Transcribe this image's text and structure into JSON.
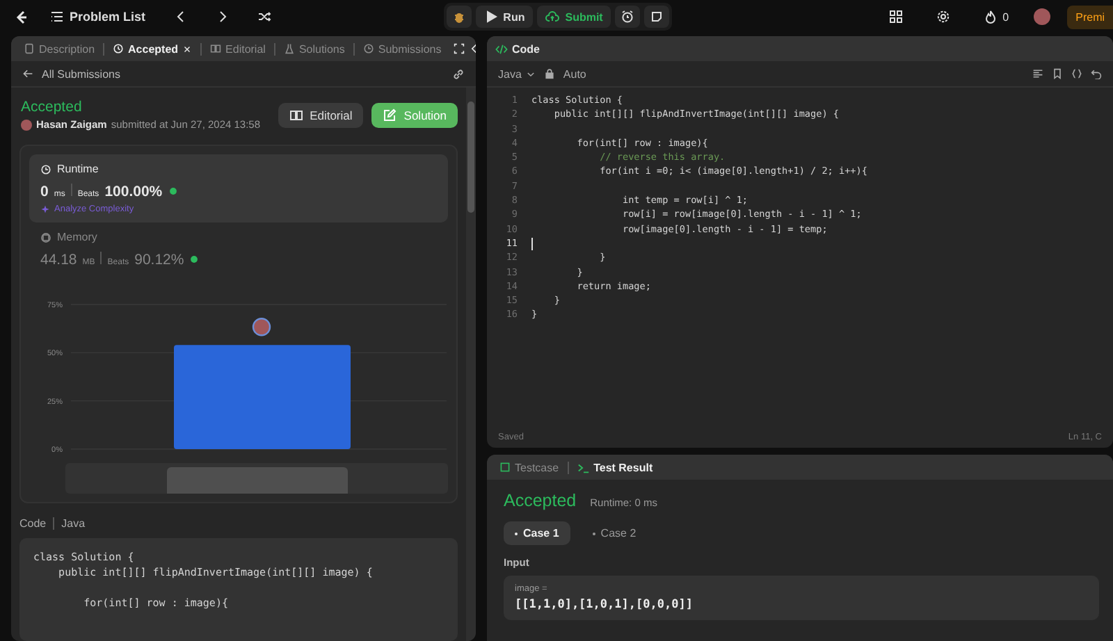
{
  "top_bar": {
    "problem_list": "Problem List",
    "run": "Run",
    "submit": "Submit",
    "streak": "0",
    "premium": "Premi"
  },
  "left_panel": {
    "tabs": [
      {
        "label": "Description",
        "selected": false,
        "closable": false
      },
      {
        "label": "Accepted",
        "selected": true,
        "closable": true
      },
      {
        "label": "Editorial",
        "selected": false,
        "closable": false
      },
      {
        "label": "Solutions",
        "selected": false,
        "closable": false
      },
      {
        "label": "Submissions",
        "selected": false,
        "closable": false
      }
    ],
    "back_link": "All Submissions",
    "submission": {
      "status": "Accepted",
      "user": "Hasan Zaigam",
      "submitted": "submitted at Jun 27, 2024 13:58",
      "editorial_button": "Editorial",
      "solution_button": "Solution"
    },
    "metrics": [
      {
        "kind": "runtime",
        "title": "Runtime",
        "value": "0",
        "unit": "ms",
        "beats_label": "Beats",
        "beats": "100.00%",
        "analyze": "Analyze Complexity",
        "selected": true
      },
      {
        "kind": "memory",
        "title": "Memory",
        "value": "44.18",
        "unit": "MB",
        "beats_label": "Beats",
        "beats": "90.12%",
        "selected": false
      }
    ],
    "chart_data": {
      "type": "bar",
      "values": [
        54
      ],
      "ylim": [
        0,
        75
      ],
      "yticks": [
        {
          "value": 0,
          "label": "0%"
        },
        {
          "value": 25,
          "label": "25%"
        },
        {
          "value": 50,
          "label": "50%"
        },
        {
          "value": 75,
          "label": "75%"
        }
      ]
    },
    "code_label": "Code",
    "code_language": "Java",
    "code_preview": [
      {
        "kind": "code",
        "text": "class Solution {"
      },
      {
        "kind": "code",
        "text": "    public int[][] flipAndInvertImage(int[][] image) {"
      },
      {
        "kind": "blank"
      },
      {
        "kind": "code",
        "text": "        for(int[] row : image){"
      }
    ]
  },
  "editor": {
    "title": "Code",
    "language": "Java",
    "mode": "Auto",
    "lines": [
      {
        "number": "1",
        "text": "class Solution {",
        "kind": "code",
        "current": false
      },
      {
        "number": "2",
        "text": "    public int[][] flipAndInvertImage(int[][] image) {",
        "kind": "code",
        "current": false
      },
      {
        "number": "3",
        "kind": "blank",
        "current": false
      },
      {
        "number": "4",
        "text": "        for(int[] row : image){",
        "kind": "code",
        "current": false
      },
      {
        "number": "5",
        "text": "            // reverse this array.",
        "kind": "comment",
        "current": false
      },
      {
        "number": "6",
        "text": "            for(int i =0; i< (image[0].length+1) / 2; i++){",
        "kind": "code",
        "current": false
      },
      {
        "number": "7",
        "kind": "blank",
        "current": false
      },
      {
        "number": "8",
        "text": "                int temp = row[i] ^ 1;",
        "kind": "code",
        "current": false
      },
      {
        "number": "9",
        "text": "                row[i] = row[image[0].length - i - 1] ^ 1;",
        "kind": "code",
        "current": false
      },
      {
        "number": "10",
        "text": "                row[image[0].length - i - 1] = temp;",
        "kind": "code",
        "current": false
      },
      {
        "number": "11",
        "kind": "blank",
        "current": true
      },
      {
        "number": "12",
        "text": "            }",
        "kind": "code",
        "current": false
      },
      {
        "number": "13",
        "text": "        }",
        "kind": "code",
        "current": false
      },
      {
        "number": "14",
        "text": "        return image;",
        "kind": "code",
        "current": false
      },
      {
        "number": "15",
        "text": "    }",
        "kind": "code",
        "current": false
      },
      {
        "number": "16",
        "text": "}",
        "kind": "code",
        "current": false
      }
    ],
    "status": "Saved",
    "position": "Ln 11, C"
  },
  "results": {
    "tabs": [
      {
        "label": "Testcase",
        "selected": false
      },
      {
        "label": "Test Result",
        "selected": true
      }
    ],
    "status": "Accepted",
    "runtime": "Runtime: 0 ms",
    "cases": [
      {
        "label": "Case 1",
        "selected": true
      },
      {
        "label": "Case 2",
        "selected": false
      }
    ],
    "input_label": "Input",
    "input_name": "image =",
    "input_value": "[[1,1,0],[1,0,1],[0,0,0]]"
  }
}
